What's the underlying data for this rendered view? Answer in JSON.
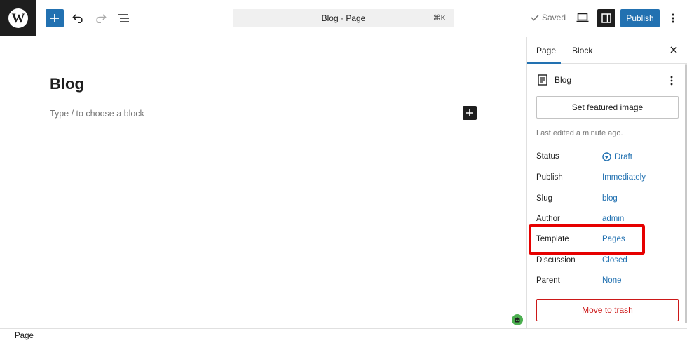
{
  "topbar": {
    "logo_letter": "W",
    "document_title": "Blog · Page",
    "shortcut": "⌘K",
    "saved_label": "Saved",
    "publish_label": "Publish",
    "icons": [
      "plus-icon",
      "undo-icon",
      "redo-icon",
      "list-view-icon",
      "check-icon",
      "desktop-view-icon",
      "settings-sidebar-icon",
      "more-vertical-icon"
    ]
  },
  "editor": {
    "title": "Blog",
    "placeholder": "Type / to choose a block"
  },
  "sidebar": {
    "tabs": [
      {
        "label": "Page",
        "active": true
      },
      {
        "label": "Block",
        "active": false
      }
    ],
    "document_name": "Blog",
    "featured_image_label": "Set featured image",
    "last_edited": "Last edited a minute ago.",
    "rows": [
      {
        "label": "Status",
        "value": "Draft"
      },
      {
        "label": "Publish",
        "value": "Immediately"
      },
      {
        "label": "Slug",
        "value": "blog"
      },
      {
        "label": "Author",
        "value": "admin"
      },
      {
        "label": "Template",
        "value": "Pages"
      },
      {
        "label": "Discussion",
        "value": "Closed"
      },
      {
        "label": "Parent",
        "value": "None"
      }
    ],
    "trash_label": "Move to trash"
  },
  "footer": {
    "breadcrumb": "Page"
  },
  "colors": {
    "accent": "#2271b1",
    "dark": "#1e1e1e",
    "danger": "#cc1818",
    "highlight": "#e60000"
  }
}
